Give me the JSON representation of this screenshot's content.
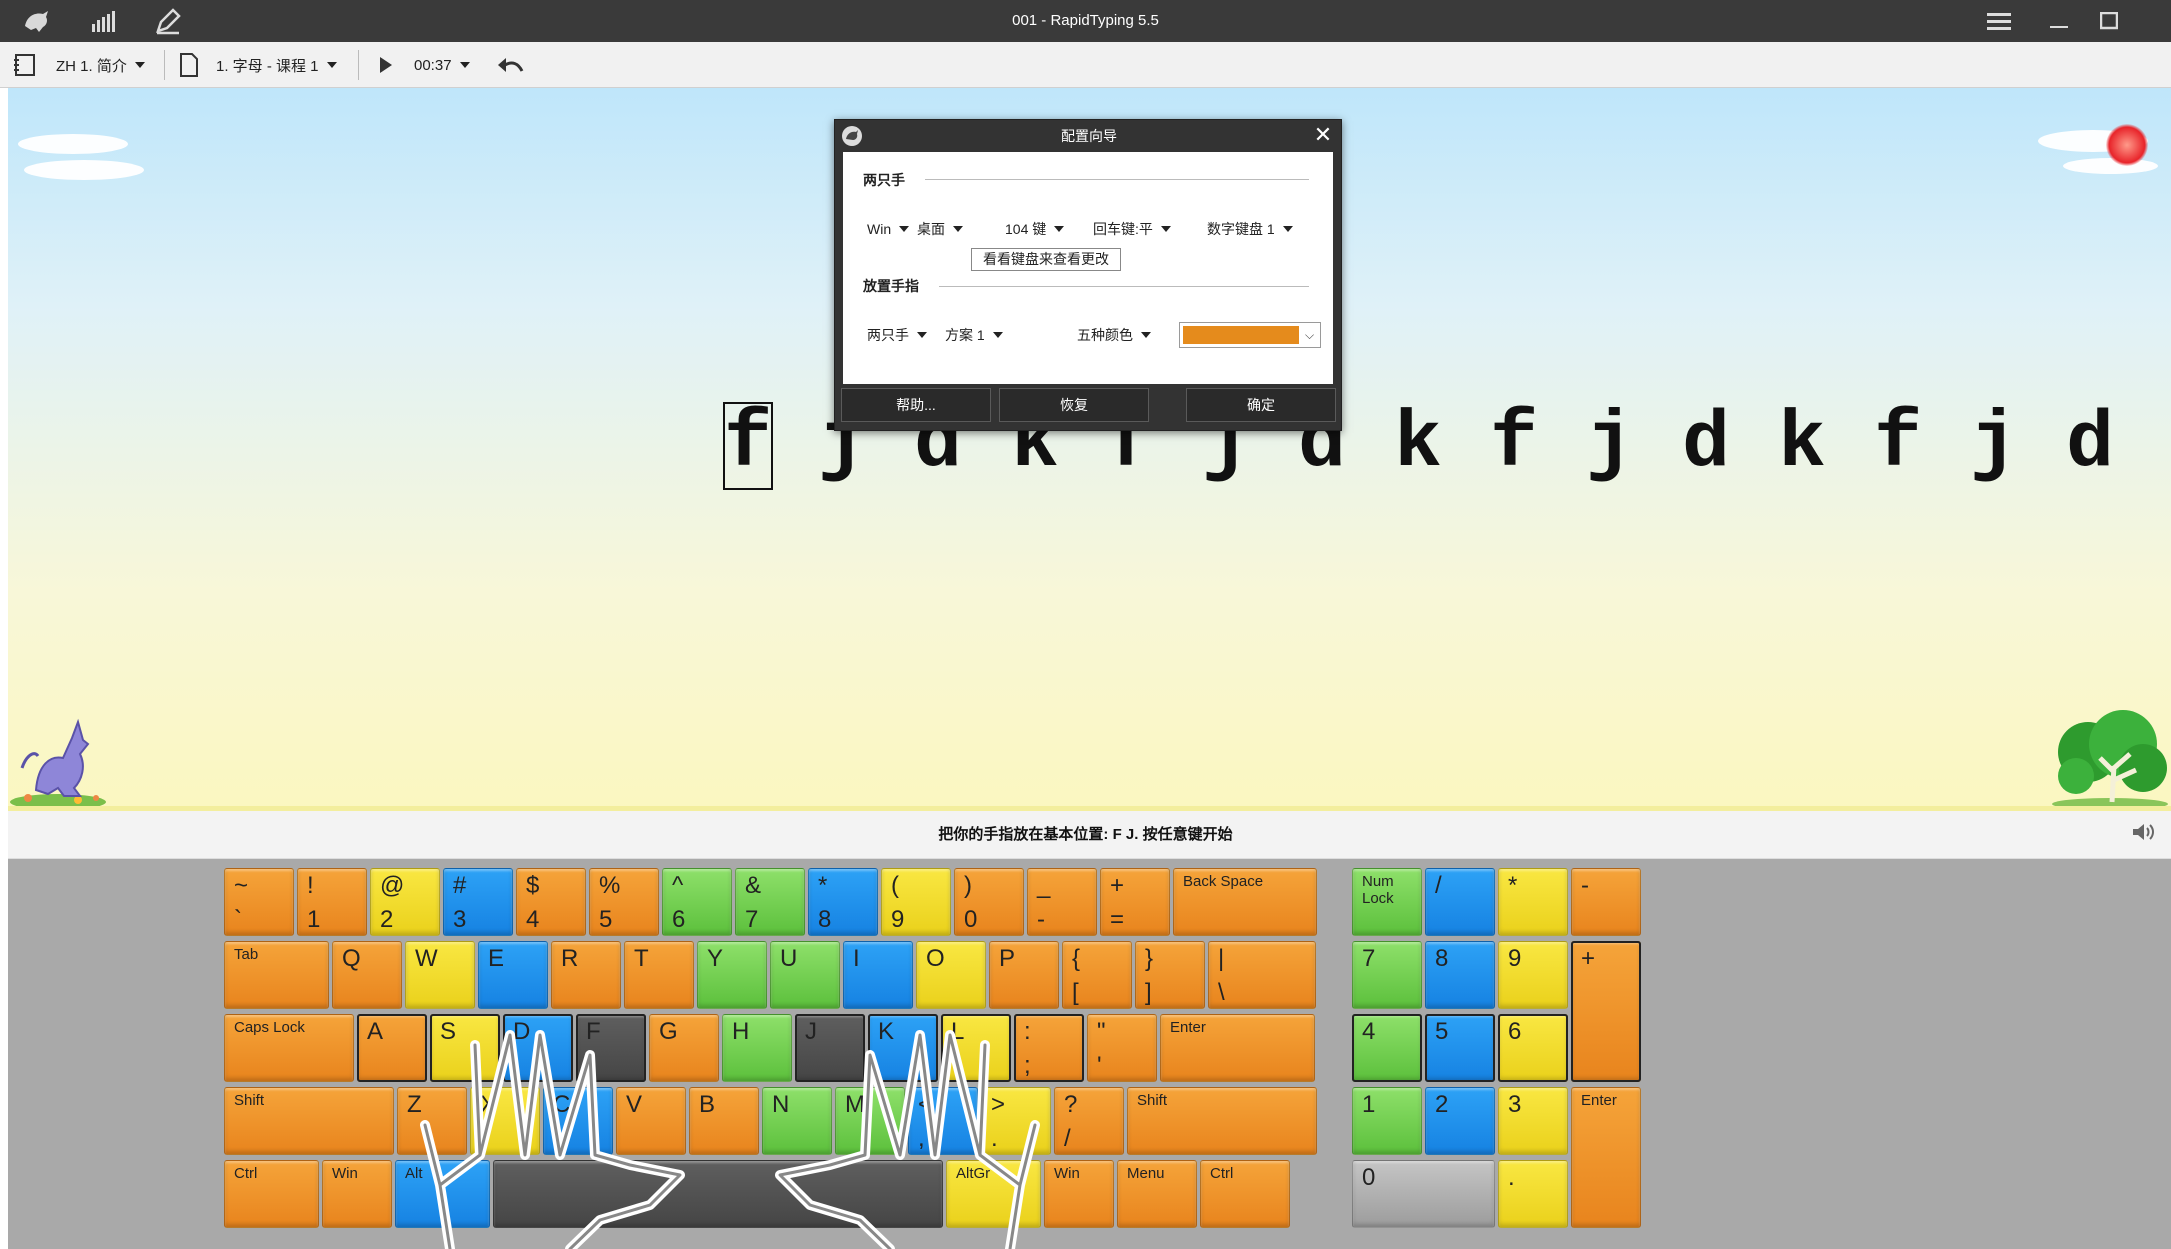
{
  "window": {
    "title": "001 - RapidTyping 5.5",
    "icons": [
      "kangaroo-icon",
      "stats-icon",
      "edit-icon"
    ],
    "controls": [
      "menu-icon",
      "minimize-icon",
      "maximize-icon"
    ]
  },
  "toolbar": {
    "course": "ZH 1. 简介",
    "lesson": "1. 字母 - 课程 1",
    "time": "00:37"
  },
  "dialog": {
    "title": "配置向导",
    "section_hands": "两只手",
    "os": "Win",
    "layout": "桌面",
    "keys": "104 键",
    "enter": "回车键:平",
    "numpad": "数字键盘 1",
    "view_button": "看看键盘来查看更改",
    "section_fingers": "放置手指",
    "hands": "两只手",
    "scheme": "方案 1",
    "colors": "五种颜色",
    "color_value": "#e58b1c",
    "help": "帮助...",
    "reset": "恢复",
    "ok": "确定"
  },
  "exercise": {
    "glyphs": [
      "f",
      "j",
      "d",
      "k",
      "f",
      "j",
      "d",
      "k",
      "f",
      "j",
      "d",
      "k",
      "f",
      "j",
      "d"
    ]
  },
  "status": {
    "text": "把你的手指放在基本位置: F J. 按任意键开始"
  },
  "keyboard": {
    "row1": [
      {
        "t": "~",
        "b": "`"
      },
      {
        "t": "!",
        "b": "1"
      },
      {
        "t": "@",
        "b": "2"
      },
      {
        "t": "#",
        "b": "3"
      },
      {
        "t": "$",
        "b": "4"
      },
      {
        "t": "%",
        "b": "5"
      },
      {
        "t": "^",
        "b": "6"
      },
      {
        "t": "&",
        "b": "7"
      },
      {
        "t": "*",
        "b": "8"
      },
      {
        "t": "(",
        "b": "9"
      },
      {
        "t": ")",
        "b": "0"
      },
      {
        "t": "_",
        "b": "-"
      },
      {
        "t": "+",
        "b": "="
      },
      {
        "w": "Back Space"
      }
    ],
    "row2": [
      {
        "w": "Tab"
      },
      {
        "t": "Q"
      },
      {
        "t": "W"
      },
      {
        "t": "E"
      },
      {
        "t": "R"
      },
      {
        "t": "T"
      },
      {
        "t": "Y"
      },
      {
        "t": "U"
      },
      {
        "t": "I"
      },
      {
        "t": "O"
      },
      {
        "t": "P"
      },
      {
        "t": "{",
        "b": "["
      },
      {
        "t": "}",
        "b": "]"
      },
      {
        "t": "|",
        "b": "\\"
      }
    ],
    "row3": [
      {
        "w": "Caps Lock"
      },
      {
        "t": "A"
      },
      {
        "t": "S"
      },
      {
        "t": "D"
      },
      {
        "t": "F"
      },
      {
        "t": "G"
      },
      {
        "t": "H"
      },
      {
        "t": "J"
      },
      {
        "t": "K"
      },
      {
        "t": "L"
      },
      {
        "t": ":",
        "b": ";"
      },
      {
        "t": "\"",
        "b": "'"
      },
      {
        "w": "Enter"
      }
    ],
    "row4": [
      {
        "w": "Shift"
      },
      {
        "t": "Z"
      },
      {
        "t": "X"
      },
      {
        "t": "C"
      },
      {
        "t": "V"
      },
      {
        "t": "B"
      },
      {
        "t": "N"
      },
      {
        "t": "M"
      },
      {
        "t": "<",
        "b": ","
      },
      {
        "t": ">",
        "b": "."
      },
      {
        "t": "?",
        "b": "/"
      },
      {
        "w": "Shift"
      }
    ],
    "row5": [
      {
        "w": "Ctrl"
      },
      {
        "w": "Win"
      },
      {
        "w": "Alt"
      },
      {
        "w": ""
      },
      {
        "w": "AltGr"
      },
      {
        "w": "Win"
      },
      {
        "w": "Menu"
      },
      {
        "w": "Ctrl"
      }
    ],
    "numpad": [
      {
        "w": "Num",
        "w2": "Lock"
      },
      {
        "t": "/"
      },
      {
        "t": "*"
      },
      {
        "t": "-"
      },
      {
        "t": "7"
      },
      {
        "t": "8"
      },
      {
        "t": "9"
      },
      {
        "t": "+"
      },
      {
        "t": "4"
      },
      {
        "t": "5"
      },
      {
        "t": "6"
      },
      {
        "t": "1"
      },
      {
        "t": "2"
      },
      {
        "t": "3"
      },
      {
        "w": "Enter"
      },
      {
        "t": "0"
      },
      {
        "t": "."
      }
    ]
  }
}
